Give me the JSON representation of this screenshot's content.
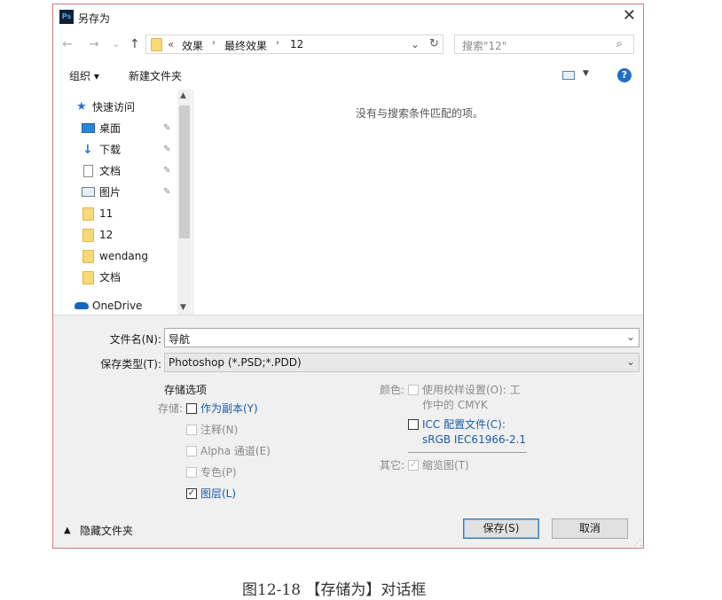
{
  "window": {
    "title": "另存为",
    "app_icon": "Ps"
  },
  "nav": {
    "back": "←",
    "forward": "→",
    "recent": "⌄",
    "up": "↑",
    "breadcrumb": {
      "prefix": "«",
      "parts": [
        "效果",
        "最终效果",
        "12"
      ]
    },
    "search_placeholder": "搜索\"12\""
  },
  "toolbar": {
    "organize": "组织 ▾",
    "new_folder": "新建文件夹"
  },
  "sidebar": {
    "quick_access": "快速访问",
    "items": [
      "桌面",
      "下载",
      "文档",
      "图片",
      "11",
      "12",
      "wendang",
      "文档"
    ],
    "onedrive": "OneDrive"
  },
  "content": {
    "empty_message": "没有与搜索条件匹配的项。"
  },
  "form": {
    "filename_label": "文件名(N):",
    "filename_value": "导航",
    "type_label": "保存类型(T):",
    "type_value": "Photoshop (*.PSD;*.PDD)"
  },
  "options": {
    "section_title": "存储选项",
    "save_label": "存储:",
    "as_copy": "作为副本(Y)",
    "notes": "注释(N)",
    "alpha": "Alpha 通道(E)",
    "spot": "专色(P)",
    "layers": "图层(L)",
    "color_label": "颜色:",
    "use_proof_1": "使用校样设置(O): 工",
    "use_proof_2": "作中的 CMYK",
    "icc_1": "ICC 配置文件(C):",
    "icc_2": "sRGB IEC61966-2.1",
    "other_label": "其它:",
    "thumbnail": "缩览图(T)"
  },
  "footer": {
    "hide_folders": "隐藏文件夹",
    "save": "保存(S)",
    "cancel": "取消"
  },
  "caption": "图12-18 【存储为】对话框",
  "colors": {
    "accent": "#1a5aa8",
    "border": "#d07a7a",
    "folder": "#f8d976"
  }
}
